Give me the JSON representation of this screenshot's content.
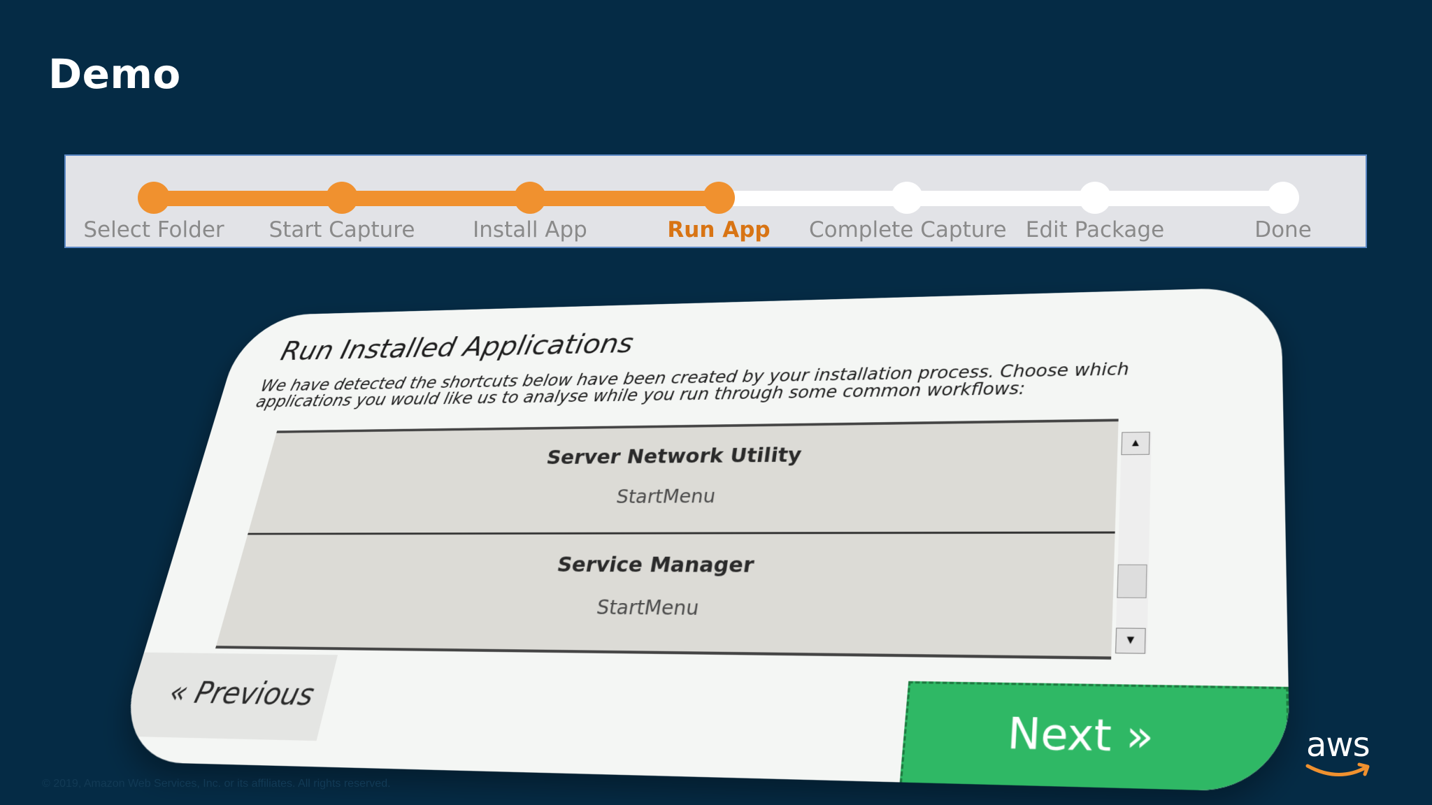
{
  "slide": {
    "title": "Demo",
    "copyright": "© 2019, Amazon Web Services, Inc. or its affiliates. All rights reserved."
  },
  "stepper": {
    "current_index": 3,
    "colors": {
      "active": "#f0912f",
      "inactive": "#ffffff",
      "current_label": "#d87414"
    },
    "steps": [
      {
        "label": "Select Folder",
        "state": "done"
      },
      {
        "label": "Start Capture",
        "state": "done"
      },
      {
        "label": "Install App",
        "state": "done"
      },
      {
        "label": "Run App",
        "state": "current"
      },
      {
        "label": "Complete Capture",
        "state": "pending"
      },
      {
        "label": "Edit Package",
        "state": "pending"
      },
      {
        "label": "Done",
        "state": "pending"
      }
    ]
  },
  "app": {
    "heading": "Run Installed Applications",
    "description": "We have detected the shortcuts below have been created by your installation process. Choose which applications you would like us to analyse while you run through some common workflows:",
    "list": [
      {
        "name": "Server Network Utility",
        "source": "StartMenu"
      },
      {
        "name": "Service Manager",
        "source": "StartMenu"
      }
    ],
    "scroll_up_icon": "▲",
    "scroll_down_icon": "▼",
    "previous_label": "« Previous",
    "next_label": "Next »",
    "next_color": "#2fb865"
  },
  "logo": {
    "text": "aws",
    "smile_color": "#f0912f"
  }
}
